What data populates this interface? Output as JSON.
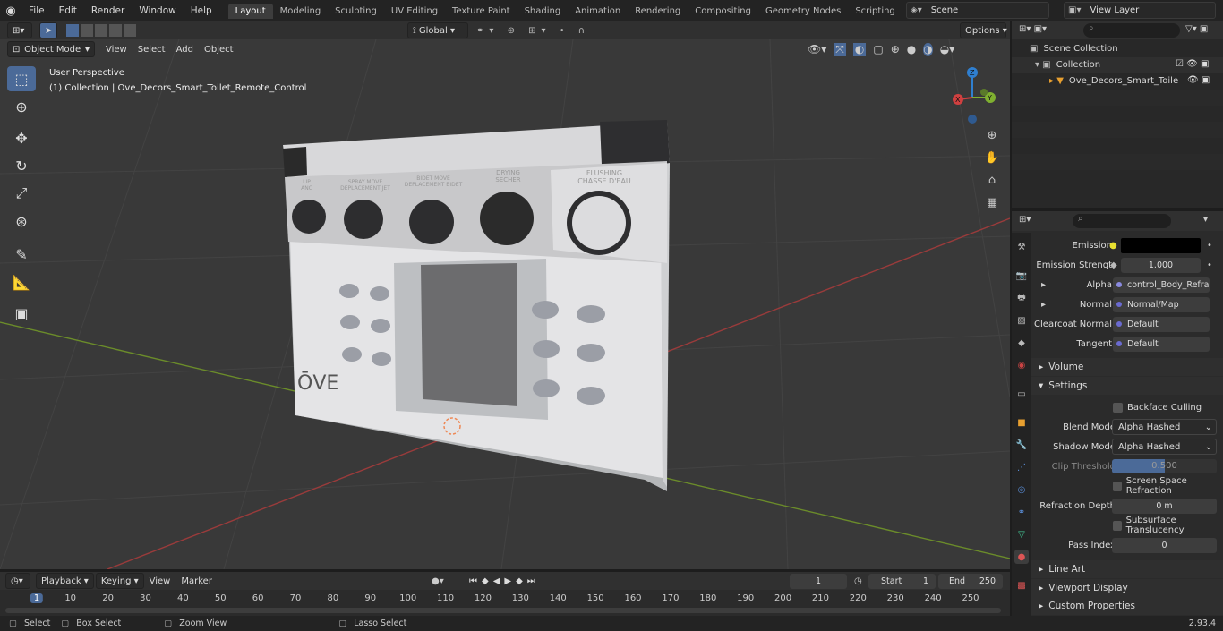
{
  "menu": [
    "File",
    "Edit",
    "Render",
    "Window",
    "Help"
  ],
  "workspaces": [
    "Layout",
    "Modeling",
    "Sculpting",
    "UV Editing",
    "Texture Paint",
    "Shading",
    "Animation",
    "Rendering",
    "Compositing",
    "Geometry Nodes",
    "Scripting"
  ],
  "scene": "Scene",
  "view_layer": "View Layer",
  "header": {
    "mode": "Object Mode",
    "view": "View",
    "select": "Select",
    "add": "Add",
    "object": "Object",
    "orientation": "Global",
    "options": "Options"
  },
  "overlay": {
    "perspective": "User Perspective",
    "collection": "(1) Collection | Ove_Decors_Smart_Toilet_Remote_Control"
  },
  "model": {
    "labels": [
      "LIP\nANC",
      "SPRAY MOVE\nDEPLACEMENT JET",
      "BIDET MOVE\nDEPLACEMENT BIDET",
      "DRYING\nSECHER",
      "FLUSHING\nCHASSE D'EAU"
    ],
    "logo": "ŌVE"
  },
  "gizmo": {
    "x": "X",
    "y": "Y",
    "z": "Z"
  },
  "outliner": {
    "scene_collection": "Scene Collection",
    "collection": "Collection",
    "object": "Ove_Decors_Smart_Toile"
  },
  "props": {
    "emission": "Emission",
    "emission_strength": "Emission Strengt",
    "emission_strength_val": "1.000",
    "alpha": "Alpha",
    "alpha_val": "control_Body_Refra...",
    "normal": "Normal",
    "normal_val": "Normal/Map",
    "clearcoat": "Clearcoat Normal",
    "clearcoat_val": "Default",
    "tangent": "Tangent",
    "tangent_val": "Default",
    "volume": "Volume",
    "settings": "Settings",
    "backface": "Backface Culling",
    "blend_mode": "Blend Mode",
    "blend_mode_val": "Alpha Hashed",
    "shadow_mode": "Shadow Mode",
    "shadow_mode_val": "Alpha Hashed",
    "clip": "Clip Threshold",
    "clip_val": "0.500",
    "clip_fraction": 0.5,
    "ssr": "Screen Space Refraction",
    "refr_depth": "Refraction Depth",
    "refr_depth_val": "0 m",
    "sss": "Subsurface Translucency",
    "pass": "Pass Index",
    "pass_val": "0",
    "line_art": "Line Art",
    "viewport_display": "Viewport Display",
    "custom_props": "Custom Properties"
  },
  "timeline": {
    "playback": "Playback",
    "keying": "Keying",
    "view": "View",
    "marker": "Marker",
    "frame": "1",
    "start_label": "Start",
    "start": "1",
    "end_label": "End",
    "end": "250",
    "ticks": [
      "1",
      "10",
      "20",
      "30",
      "40",
      "50",
      "60",
      "70",
      "80",
      "90",
      "100",
      "110",
      "120",
      "130",
      "140",
      "150",
      "160",
      "170",
      "180",
      "190",
      "200",
      "210",
      "220",
      "230",
      "240",
      "250"
    ]
  },
  "status": {
    "select": "Select",
    "box_select": "Box Select",
    "zoom_view": "Zoom View",
    "lasso_select": "Lasso Select",
    "version": "2.93.4"
  }
}
